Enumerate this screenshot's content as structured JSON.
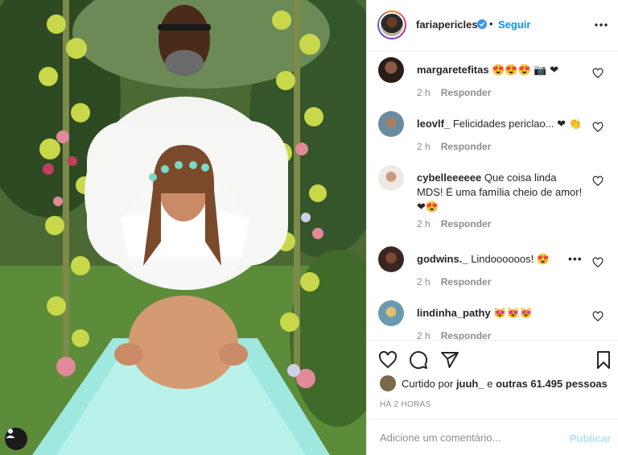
{
  "post": {
    "username": "fariapericles",
    "follow_label": "Seguir",
    "separator": "•"
  },
  "comments": [
    {
      "username": "margaretefitas",
      "text": "😍😍😍 📷 ❤",
      "age": "2 h",
      "reply": "Responder",
      "avatar": "#3b2a22"
    },
    {
      "username": "leovlf_",
      "text": "Felicidades periclao... ❤ 👏",
      "age": "2 h",
      "reply": "Responder",
      "avatar": "#5b7a8a"
    },
    {
      "username": "cybelleeeeee",
      "text": "Que coisa linda MDS! É uma família cheio de amor! ❤😍",
      "age": "2 h",
      "reply": "Responder",
      "avatar": "#d8c8c0"
    },
    {
      "username": "godwins._",
      "text": "Lindoooooos! 😍",
      "age": "2 h",
      "reply": "Responder",
      "avatar": "#4a2e22"
    },
    {
      "username": "lindinha_pathy",
      "text": "😻😻😻",
      "age": "2 h",
      "reply": "Responder",
      "avatar": "#d9c060"
    }
  ],
  "likes": {
    "prefix": "Curtido por",
    "user": "juuh_",
    "middle": "e",
    "others": "outras 61.495 pessoas"
  },
  "timestamp": "HÁ 2 HORAS",
  "add_comment": {
    "placeholder": "Adicione um comentário...",
    "publish_label": "Publicar"
  },
  "colors": {
    "accent": "#0095f6",
    "publish_disabled": "#b2dffc",
    "muted": "#8e8e8e",
    "border": "#efefef"
  },
  "icons": [
    "verified-icon",
    "more-options-icon",
    "heart-icon",
    "comment-icon",
    "share-icon",
    "bookmark-icon",
    "user-tag-icon"
  ]
}
